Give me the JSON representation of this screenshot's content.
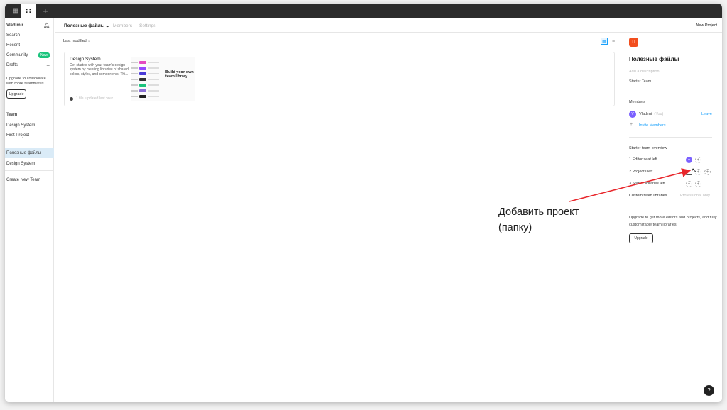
{
  "titlebar": {
    "home_icon": "grid-icon",
    "active_tab_icon": "figma-logo-icon",
    "plus_icon": "+"
  },
  "sidebar": {
    "user": "Vladimir",
    "nav": [
      {
        "label": "Search"
      },
      {
        "label": "Recent"
      },
      {
        "label": "Community",
        "badge": "New"
      },
      {
        "label": "Drafts",
        "action": "+"
      }
    ],
    "upgrade_text": "Upgrade to collaborate with more teammates",
    "upgrade_button": "Upgrade",
    "team_section": "Team",
    "team_items": [
      "Design System",
      "First Project"
    ],
    "selected_item": "Полезные файлы",
    "sub_item": "Design System",
    "create_team": "Create New Team"
  },
  "topbar": {
    "tabs": [
      {
        "label": "Полезные файлы ⌄"
      },
      {
        "label": "Members"
      },
      {
        "label": "Settings"
      }
    ],
    "new_project": "New Project"
  },
  "content": {
    "sort_label": "Last modified ⌄",
    "card": {
      "title": "Design System",
      "description": "Get started with your team's design system by creating libraries of shared colors, styles, and components. Thi...",
      "meta": "1 file, updated last hour",
      "thumbnail_text": "Build your own team library"
    }
  },
  "panel": {
    "avatar_letter": "П",
    "title": "Полезные файлы",
    "description_placeholder": "Add a description",
    "plan": "Starter Team",
    "members_heading": "Members",
    "member": {
      "initial": "V",
      "name": "Vladimir",
      "you": "(You)",
      "leave": "Leave"
    },
    "invite": "Invite Members",
    "overview_heading": "Starter team overview",
    "overview": [
      {
        "label": "1 Editor seat left"
      },
      {
        "label": "2 Projects left"
      },
      {
        "label": "3 Starter libraries left"
      },
      {
        "label": "Custom team libraries",
        "value": "Professional only"
      }
    ],
    "upgrade_text": "Upgrade to get more editors and projects, and fully customizable team libraries.",
    "upgrade_button": "Upgrade"
  },
  "annotation": {
    "line1": "Добавить проект",
    "line2": "(папку)",
    "arrow_color": "#e8262b"
  },
  "help": "?"
}
